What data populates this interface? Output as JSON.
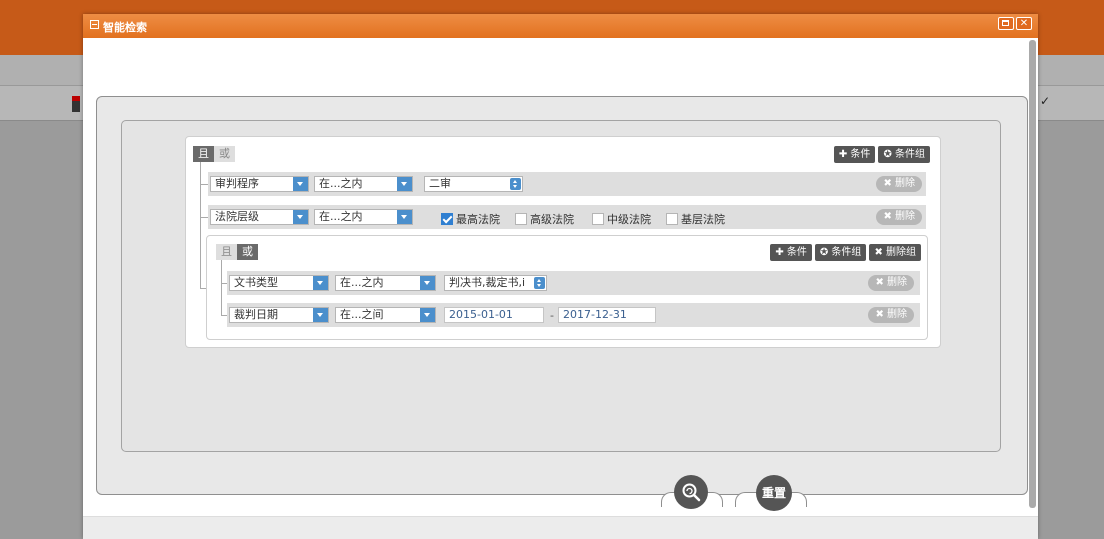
{
  "dialog": {
    "title": "智能检索"
  },
  "group1": {
    "and_label": "且",
    "or_label": "或",
    "add_condition": "✚ 条件",
    "add_group": "✪ 条件组"
  },
  "rows": [
    {
      "field": "审判程序",
      "operator": "在...之内",
      "value": "二审",
      "delete": "✖ 删除"
    },
    {
      "field": "法院层级",
      "operator": "在...之内",
      "options": [
        {
          "label": "最高法院",
          "checked": true
        },
        {
          "label": "高级法院",
          "checked": false
        },
        {
          "label": "中级法院",
          "checked": false
        },
        {
          "label": "基层法院",
          "checked": false
        }
      ],
      "delete": "✖ 删除"
    }
  ],
  "group2": {
    "and_label": "且",
    "or_label": "或",
    "add_condition": "✚ 条件",
    "add_group": "✪ 条件组",
    "delete_group": "✖ 删除组",
    "rows": [
      {
        "field": "文书类型",
        "operator": "在...之内",
        "value": "判决书,裁定书,i",
        "delete": "✖ 删除"
      },
      {
        "field": "裁判日期",
        "operator": "在...之间",
        "date_from": "2015-01-01",
        "dash": "-",
        "date_to": "2017-12-31",
        "delete": "✖ 删除"
      }
    ]
  },
  "actions": {
    "reset": "重置"
  },
  "icons": {
    "search": "search-icon",
    "window_max": "maximize-icon",
    "window_close": "close-icon"
  },
  "colors": {
    "title_bar": "#e2711f",
    "dropdown_arrow": "#4b8fcc",
    "checked": "#2f7fd1",
    "date_text": "#3a5f8f"
  }
}
